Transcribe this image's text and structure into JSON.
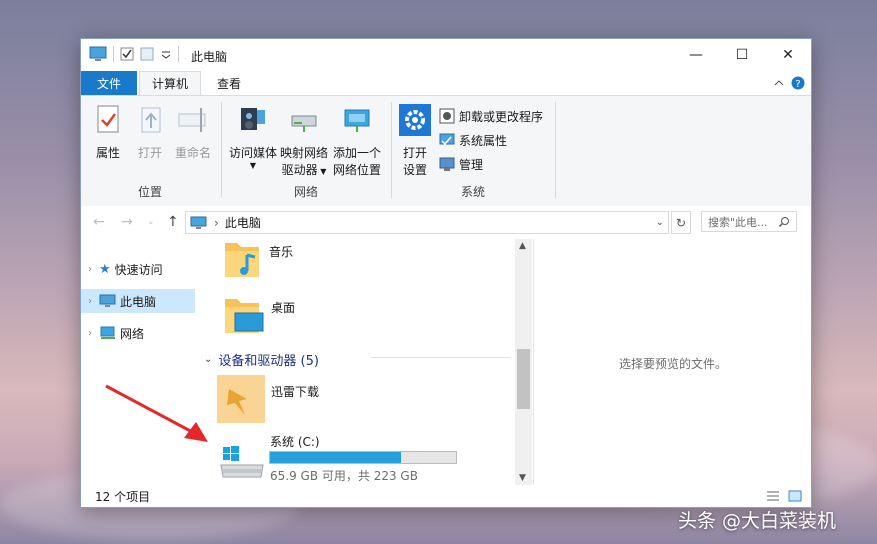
{
  "window": {
    "title": "此电脑",
    "controls": {
      "minimize": "—",
      "maximize": "☐",
      "close": "✕"
    }
  },
  "tabs": {
    "file": "文件",
    "computer": "计算机",
    "view": "查看"
  },
  "ribbon": {
    "location_group": {
      "label": "位置",
      "properties": "属性",
      "open": "打开",
      "rename": "重命名"
    },
    "network_group": {
      "label": "网络",
      "access_media": "访问媒体",
      "map_drive_line1": "映射网络",
      "map_drive_line2": "驱动器",
      "add_location_line1": "添加一个",
      "add_location_line2": "网络位置"
    },
    "system_group": {
      "label": "系统",
      "open_settings_line1": "打开",
      "open_settings_line2": "设置",
      "uninstall": "卸载或更改程序",
      "system_properties": "系统属性",
      "manage": "管理"
    }
  },
  "address": {
    "path": "此电脑",
    "search_placeholder": "搜索\"此电...",
    "separator": "›"
  },
  "navpane": {
    "items": [
      {
        "label": "快速访问"
      },
      {
        "label": "此电脑"
      },
      {
        "label": "网络"
      }
    ]
  },
  "content": {
    "folders": [
      {
        "name": "音乐"
      },
      {
        "name": "桌面"
      }
    ],
    "devices_header": "设备和驱动器 (5)",
    "devices": [
      {
        "name": "迅雷下载"
      },
      {
        "name": "系统 (C:)",
        "space_text": "65.9 GB 可用，共 223 GB",
        "used_fraction": 0.705
      }
    ]
  },
  "preview": {
    "text": "选择要预览的文件。"
  },
  "status": {
    "item_count": "12 个项目"
  },
  "watermark": "头条 @大白菜装机",
  "colors": {
    "accent": "#1979ca",
    "selected": "#cce8ff",
    "drive_fill": "#26a0da",
    "arrow": "#e5262a"
  }
}
